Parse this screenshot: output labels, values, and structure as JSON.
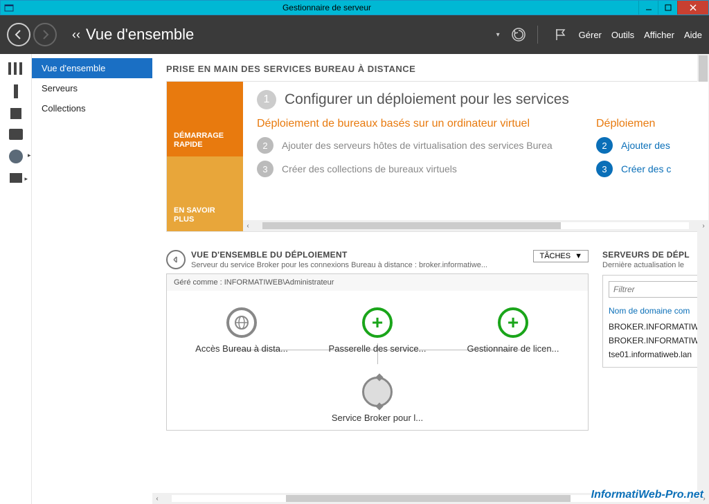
{
  "window": {
    "title": "Gestionnaire de serveur"
  },
  "toolbar": {
    "breadcrumb_lead": "‹‹",
    "page_title": "Vue d'ensemble",
    "menu": {
      "manage": "Gérer",
      "tools": "Outils",
      "view": "Afficher",
      "help": "Aide"
    }
  },
  "nav": {
    "items": [
      {
        "label": "Vue d'ensemble",
        "selected": true
      },
      {
        "label": "Serveurs",
        "selected": false
      },
      {
        "label": "Collections",
        "selected": false
      }
    ]
  },
  "quickstart": {
    "section_header": "PRISE EN MAIN DES SERVICES BUREAU À DISTANCE",
    "tabs": {
      "start": "DÉMARRAGE RAPIDE",
      "learn": "EN SAVOIR PLUS"
    },
    "big_step_num": "1",
    "big_step_title": "Configurer un déploiement pour les services",
    "colA": {
      "heading": "Déploiement de bureaux basés sur un ordinateur virtuel",
      "steps": [
        {
          "n": "2",
          "text": "Ajouter des serveurs hôtes de virtualisation des services Burea"
        },
        {
          "n": "3",
          "text": "Créer des collections de bureaux virtuels"
        }
      ]
    },
    "colB": {
      "heading": "Déploiemen",
      "steps": [
        {
          "n": "2",
          "text": "Ajouter des"
        },
        {
          "n": "3",
          "text": "Créer des c"
        }
      ]
    }
  },
  "deployment": {
    "title": "VUE D'ENSEMBLE DU DÉPLOIEMENT",
    "subtitle": "Serveur du service Broker pour les connexions Bureau à distance : broker.informatiwe...",
    "tasks_label": "TÂCHES",
    "managed_as_prefix": "Géré comme : ",
    "managed_as_value": "INFORMATIWEB\\Administrateur",
    "nodes": {
      "web_access": "Accès Bureau à dista...",
      "gateway": "Passerelle des service...",
      "licensing": "Gestionnaire de licen...",
      "broker": "Service Broker pour l..."
    }
  },
  "servers_panel": {
    "title": "SERVEURS DE DÉPL",
    "subtitle": "Dernière actualisation le",
    "filter_placeholder": "Filtrer",
    "column_header": "Nom de domaine com",
    "rows": [
      "BROKER.INFORMATIW",
      "BROKER.INFORMATIW",
      "tse01.informatiweb.lan"
    ]
  },
  "watermark": "InformatiWeb-Pro.net"
}
